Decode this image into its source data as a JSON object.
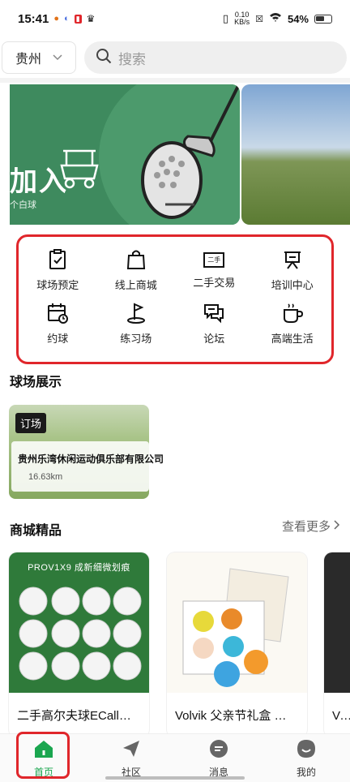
{
  "status_bar": {
    "time": "15:41",
    "net_speed_value": "0.10",
    "net_speed_unit": "KB/s",
    "battery": "54%"
  },
  "top_bar": {
    "city": "贵州",
    "search_placeholder": "搜索"
  },
  "banner": {
    "headline": "加入",
    "subtext": "个白球"
  },
  "functions": [
    {
      "label": "球场预定",
      "icon": "clipboard-check-icon"
    },
    {
      "label": "线上商城",
      "icon": "shopping-bag-icon"
    },
    {
      "label": "二手交易",
      "icon": "secondhand-tag-icon",
      "icon_text": "二手"
    },
    {
      "label": "培训中心",
      "icon": "presentation-board-icon"
    },
    {
      "label": "约球",
      "icon": "calendar-clock-icon"
    },
    {
      "label": "练习场",
      "icon": "golf-flag-icon"
    },
    {
      "label": "论坛",
      "icon": "chat-bubbles-icon"
    },
    {
      "label": "高端生活",
      "icon": "coffee-cup-icon"
    }
  ],
  "course_section": {
    "title": "球场展示",
    "card": {
      "tag": "订场",
      "name": "贵州乐湾休闲运动俱乐部有限公司",
      "distance": "16.63km"
    }
  },
  "mall_section": {
    "title": "商城精品",
    "more": "查看更多",
    "products": [
      {
        "name": "二手高尔夫球ECall…",
        "promo": "PROV1X9 成新细微划痕"
      },
      {
        "name": "Volvik 父亲节礼盒 …"
      },
      {
        "name": "Vol"
      }
    ]
  },
  "bottom_nav": [
    {
      "label": "首页",
      "icon": "home-icon",
      "active": true
    },
    {
      "label": "社区",
      "icon": "paper-plane-icon"
    },
    {
      "label": "消息",
      "icon": "message-icon"
    },
    {
      "label": "我的",
      "icon": "profile-icon"
    }
  ],
  "colors": {
    "accent_green": "#1aa64f",
    "highlight_red": "#e0262b"
  }
}
